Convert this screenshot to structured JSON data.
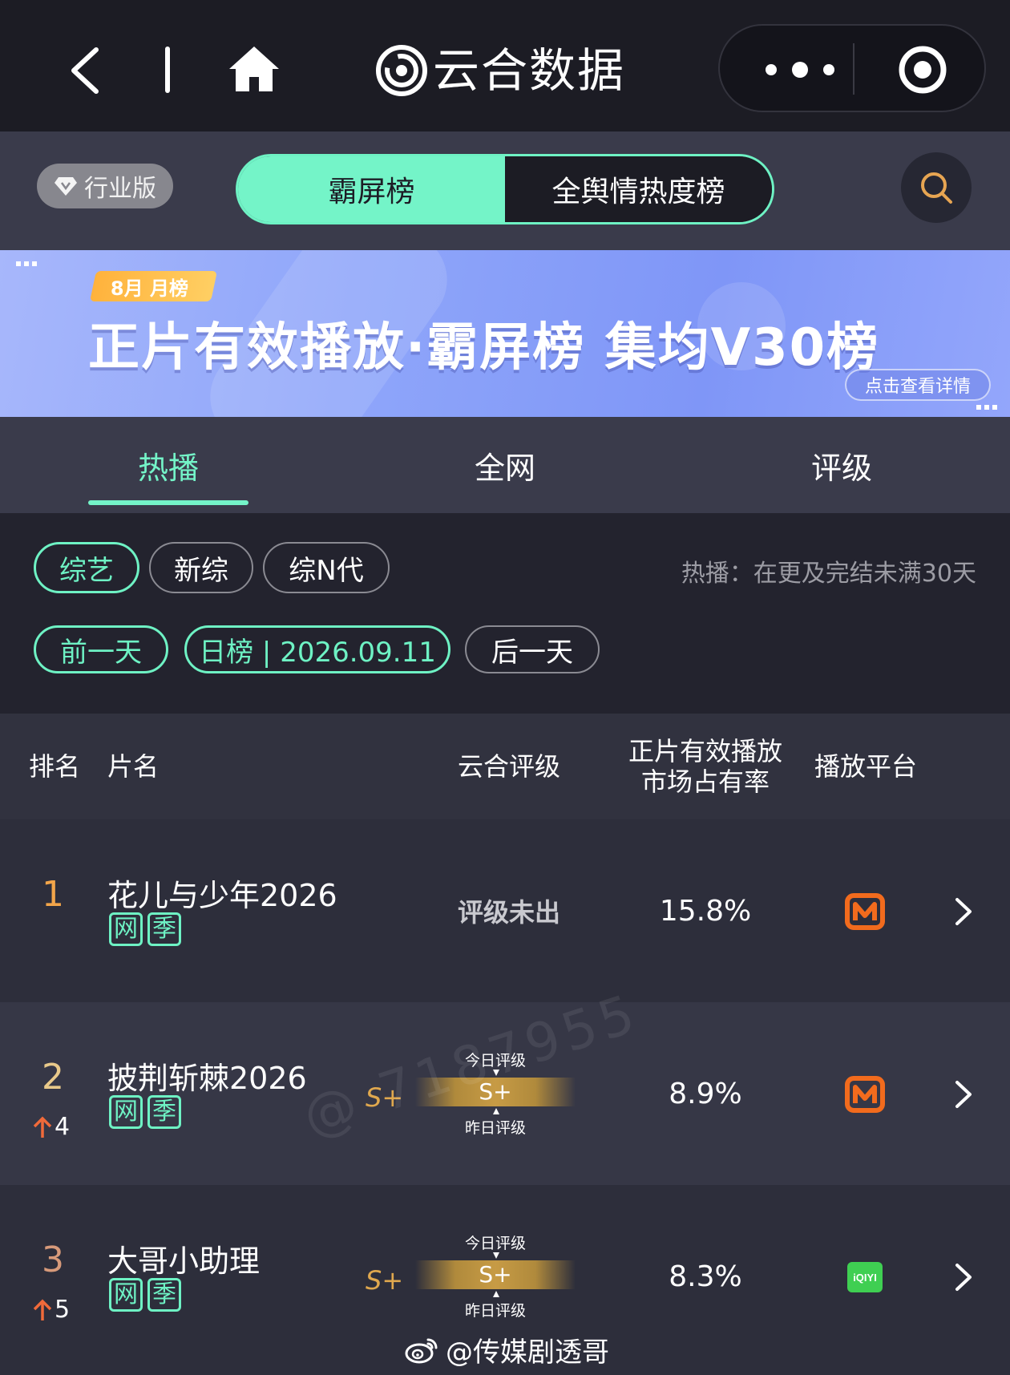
{
  "nav": {
    "brand_name": "云合数据"
  },
  "segment": {
    "edition_label": "行业版",
    "tabs": [
      "霸屏榜",
      "全舆情热度榜"
    ]
  },
  "banner": {
    "tag": "8月 月榜",
    "title": "正片有效播放·霸屏榜 集均V30榜",
    "detail_button": "点击查看详情"
  },
  "tabs": [
    "热播",
    "全网",
    "评级"
  ],
  "filters": {
    "categories": [
      "综艺",
      "新综",
      "综N代"
    ],
    "hint": "热播：在更及完结未满30天",
    "prev_day": "前一天",
    "date_label": "日榜 | 2026.09.11",
    "next_day": "后一天"
  },
  "table": {
    "headers": {
      "rank": "排名",
      "name": "片名",
      "rating": "云合评级",
      "share_line1": "正片有效播放",
      "share_line2": "市场占有率",
      "platform": "播放平台"
    },
    "rating_labels": {
      "today": "今日评级",
      "yesterday": "昨日评级"
    },
    "rows": [
      {
        "rank": "1",
        "rank_color": "#f2a54a",
        "delta": "",
        "title": "花儿与少年2026",
        "badges": [
          "网",
          "季"
        ],
        "rating_text": "评级未出",
        "rating_prev": "",
        "rating_today": "",
        "share": "15.8%",
        "platform": "mango-tv-icon"
      },
      {
        "rank": "2",
        "rank_color": "#e9c98a",
        "delta": "4",
        "title": "披荆斩棘2026",
        "badges": [
          "网",
          "季"
        ],
        "rating_text": "",
        "rating_prev": "S+",
        "rating_today": "S+",
        "share": "8.9%",
        "platform": "mango-tv-icon"
      },
      {
        "rank": "3",
        "rank_color": "#d79a7a",
        "delta": "5",
        "title": "大哥小助理",
        "badges": [
          "网",
          "季"
        ],
        "rating_text": "",
        "rating_prev": "S+",
        "rating_today": "S+",
        "share": "8.3%",
        "platform": "iqiyi-icon"
      }
    ]
  },
  "watermark": "@ 7187955",
  "footer": {
    "credit": "@传媒剧透哥"
  },
  "colors": {
    "accent": "#74f4c8",
    "up_arrow": "#f06a3a",
    "mango": "#f26b1d",
    "iqiyi": "#3fcf52"
  }
}
